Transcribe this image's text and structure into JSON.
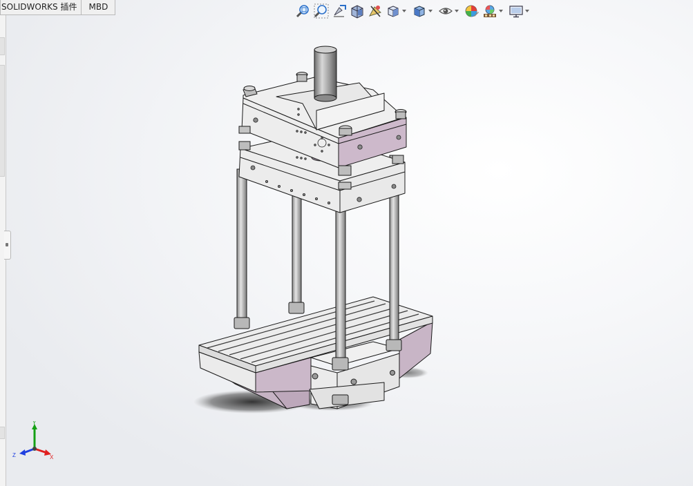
{
  "tabs": [
    {
      "label": "SOLIDWORKS 插件"
    },
    {
      "label": "MBD"
    }
  ],
  "heads_up_toolbar": [
    {
      "name": "zoom-to-fit-icon"
    },
    {
      "name": "zoom-to-area-icon"
    },
    {
      "name": "previous-view-icon"
    },
    {
      "name": "section-view-icon"
    },
    {
      "name": "dynamic-annotation-view-icon"
    },
    {
      "name": "view-orientation-icon"
    },
    {
      "name": "display-style-icon"
    },
    {
      "name": "hide-show-items-icon"
    },
    {
      "name": "edit-appearance-icon"
    },
    {
      "name": "apply-scene-icon"
    },
    {
      "name": "view-settings-icon"
    }
  ],
  "triad": {
    "x_label": "X",
    "y_label": "Y",
    "z_label": "Z"
  },
  "colors": {
    "part_light": "#ececec",
    "part_side": "#cdb7c9",
    "edge": "#1a1a1a",
    "axis_x": "#e02020",
    "axis_y": "#14a014",
    "axis_z": "#2040e0"
  }
}
